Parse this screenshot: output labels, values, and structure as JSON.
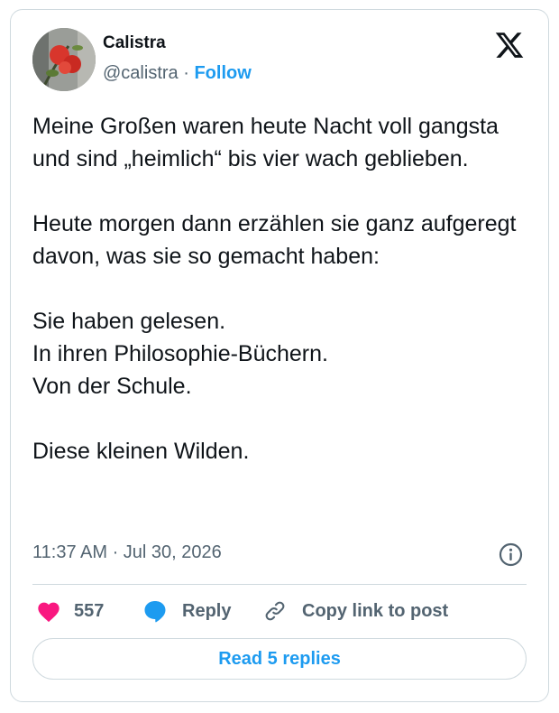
{
  "post": {
    "author_name": "Calistra",
    "handle": "@calistra",
    "separator": "·",
    "follow_label": "Follow",
    "text": "Meine Großen waren heute Nacht voll gangsta und sind „heimlich“ bis vier wach geblieben.\n\nHeute morgen dann erzählen sie ganz aufgeregt davon, was sie so gemacht haben:\n\nSie haben gelesen.\nIn ihren Philosophie-Büchern.\nVon der Schule.\n\nDiese kleinen Wilden.",
    "timestamp": "11:37 AM · Jul 30, 2026"
  },
  "actions": {
    "like_count": "557",
    "reply_label": "Reply",
    "copy_label": "Copy link to post"
  },
  "read_replies_label": "Read 5 replies",
  "icons": {
    "platform": "x-logo-icon",
    "info": "info-icon",
    "like": "heart-icon",
    "reply": "speech-bubble-icon",
    "copy": "link-icon"
  },
  "colors": {
    "accent": "#1d9bf0",
    "like": "#f91880",
    "text": "#0f1419",
    "secondary": "#536471",
    "border": "#cfd9de"
  }
}
